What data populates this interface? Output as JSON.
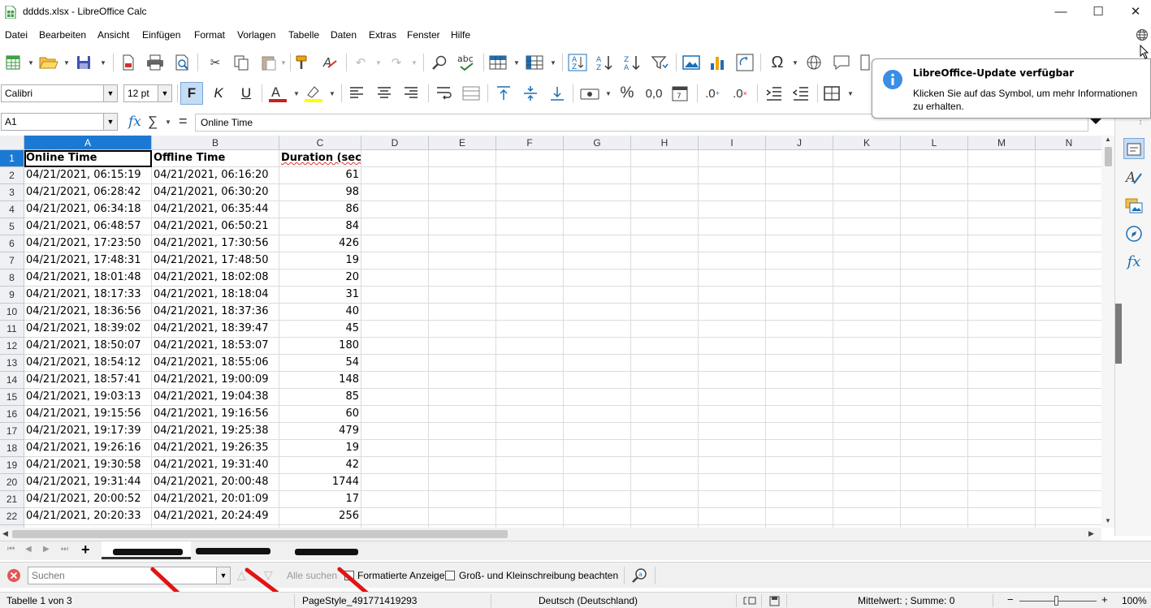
{
  "window": {
    "title": "dddds.xlsx - LibreOffice Calc",
    "minimize": "—",
    "maximize": "☐",
    "close": "✕"
  },
  "menu": [
    "Datei",
    "Bearbeiten",
    "Ansicht",
    "Einfügen",
    "Format",
    "Vorlagen",
    "Tabelle",
    "Daten",
    "Extras",
    "Fenster",
    "Hilfe"
  ],
  "formatting": {
    "font_name": "Calibri",
    "font_size": "12 pt",
    "bold": "F",
    "italic": "K",
    "underline": "U"
  },
  "formula_bar": {
    "name_box": "A1",
    "fx": "fx",
    "sum": "∑",
    "equals": "=",
    "content": "Online Time"
  },
  "columns": [
    "A",
    "B",
    "C",
    "D",
    "E",
    "F",
    "G",
    "H",
    "I",
    "J",
    "K",
    "L",
    "M",
    "N"
  ],
  "rows": [
    [
      "Online Time",
      "Offline Time",
      "Duration (sec)"
    ],
    [
      "04/21/2021, 06:15:19",
      "04/21/2021, 06:16:20",
      "61"
    ],
    [
      "04/21/2021, 06:28:42",
      "04/21/2021, 06:30:20",
      "98"
    ],
    [
      "04/21/2021, 06:34:18",
      "04/21/2021, 06:35:44",
      "86"
    ],
    [
      "04/21/2021, 06:48:57",
      "04/21/2021, 06:50:21",
      "84"
    ],
    [
      "04/21/2021, 17:23:50",
      "04/21/2021, 17:30:56",
      "426"
    ],
    [
      "04/21/2021, 17:48:31",
      "04/21/2021, 17:48:50",
      "19"
    ],
    [
      "04/21/2021, 18:01:48",
      "04/21/2021, 18:02:08",
      "20"
    ],
    [
      "04/21/2021, 18:17:33",
      "04/21/2021, 18:18:04",
      "31"
    ],
    [
      "04/21/2021, 18:36:56",
      "04/21/2021, 18:37:36",
      "40"
    ],
    [
      "04/21/2021, 18:39:02",
      "04/21/2021, 18:39:47",
      "45"
    ],
    [
      "04/21/2021, 18:50:07",
      "04/21/2021, 18:53:07",
      "180"
    ],
    [
      "04/21/2021, 18:54:12",
      "04/21/2021, 18:55:06",
      "54"
    ],
    [
      "04/21/2021, 18:57:41",
      "04/21/2021, 19:00:09",
      "148"
    ],
    [
      "04/21/2021, 19:03:13",
      "04/21/2021, 19:04:38",
      "85"
    ],
    [
      "04/21/2021, 19:15:56",
      "04/21/2021, 19:16:56",
      "60"
    ],
    [
      "04/21/2021, 19:17:39",
      "04/21/2021, 19:25:38",
      "479"
    ],
    [
      "04/21/2021, 19:26:16",
      "04/21/2021, 19:26:35",
      "19"
    ],
    [
      "04/21/2021, 19:30:58",
      "04/21/2021, 19:31:40",
      "42"
    ],
    [
      "04/21/2021, 19:31:44",
      "04/21/2021, 20:00:48",
      "1744"
    ],
    [
      "04/21/2021, 20:00:52",
      "04/21/2021, 20:01:09",
      "17"
    ],
    [
      "04/21/2021, 20:20:33",
      "04/21/2021, 20:24:49",
      "256"
    ]
  ],
  "sheet_tabs": {
    "add": "+"
  },
  "find_toolbar": {
    "placeholder": "Suchen",
    "find_all": "Alle suchen",
    "formatted_display": "Formatierte Anzeige",
    "match_case": "Groß- und Kleinschreibung beachten"
  },
  "status_bar": {
    "sheet": "Tabelle 1 von 3",
    "page_style": "PageStyle_491771419293",
    "language": "Deutsch (Deutschland)",
    "sum": "Mittelwert: ; Summe: 0",
    "zoom": "100%"
  },
  "update_notice": {
    "title": "LibreOffice-Update verfügbar",
    "body": "Klicken Sie auf das Symbol, um mehr Informationen zu erhalten."
  },
  "colors": {
    "selection": "#1c79d3",
    "annotation": "#e01414",
    "info": "#3a8ee6"
  }
}
